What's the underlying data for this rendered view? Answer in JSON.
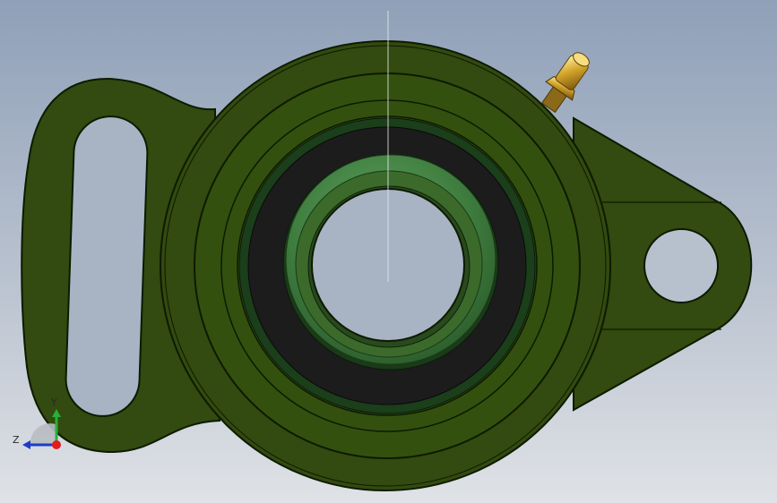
{
  "triad": {
    "y_label": "Y",
    "z_label": "Z"
  },
  "colors": {
    "background_top": "#8fa0b8",
    "background_bottom": "#dfe2e6",
    "housing": "#334a10",
    "housing_edge": "#0d1a00",
    "bearing_ring": "#1b3e1b",
    "seal": "#1c1c1c",
    "inner_ring": "#3f7d3f",
    "grease_fitting": "#d4a52a",
    "axis_x": "#e31b1b",
    "axis_y": "#27b03a",
    "axis_z": "#1e3cc8"
  },
  "icons": {
    "triad": "coordinate-triad-icon",
    "grease_fitting": "grease-nipple-icon"
  }
}
